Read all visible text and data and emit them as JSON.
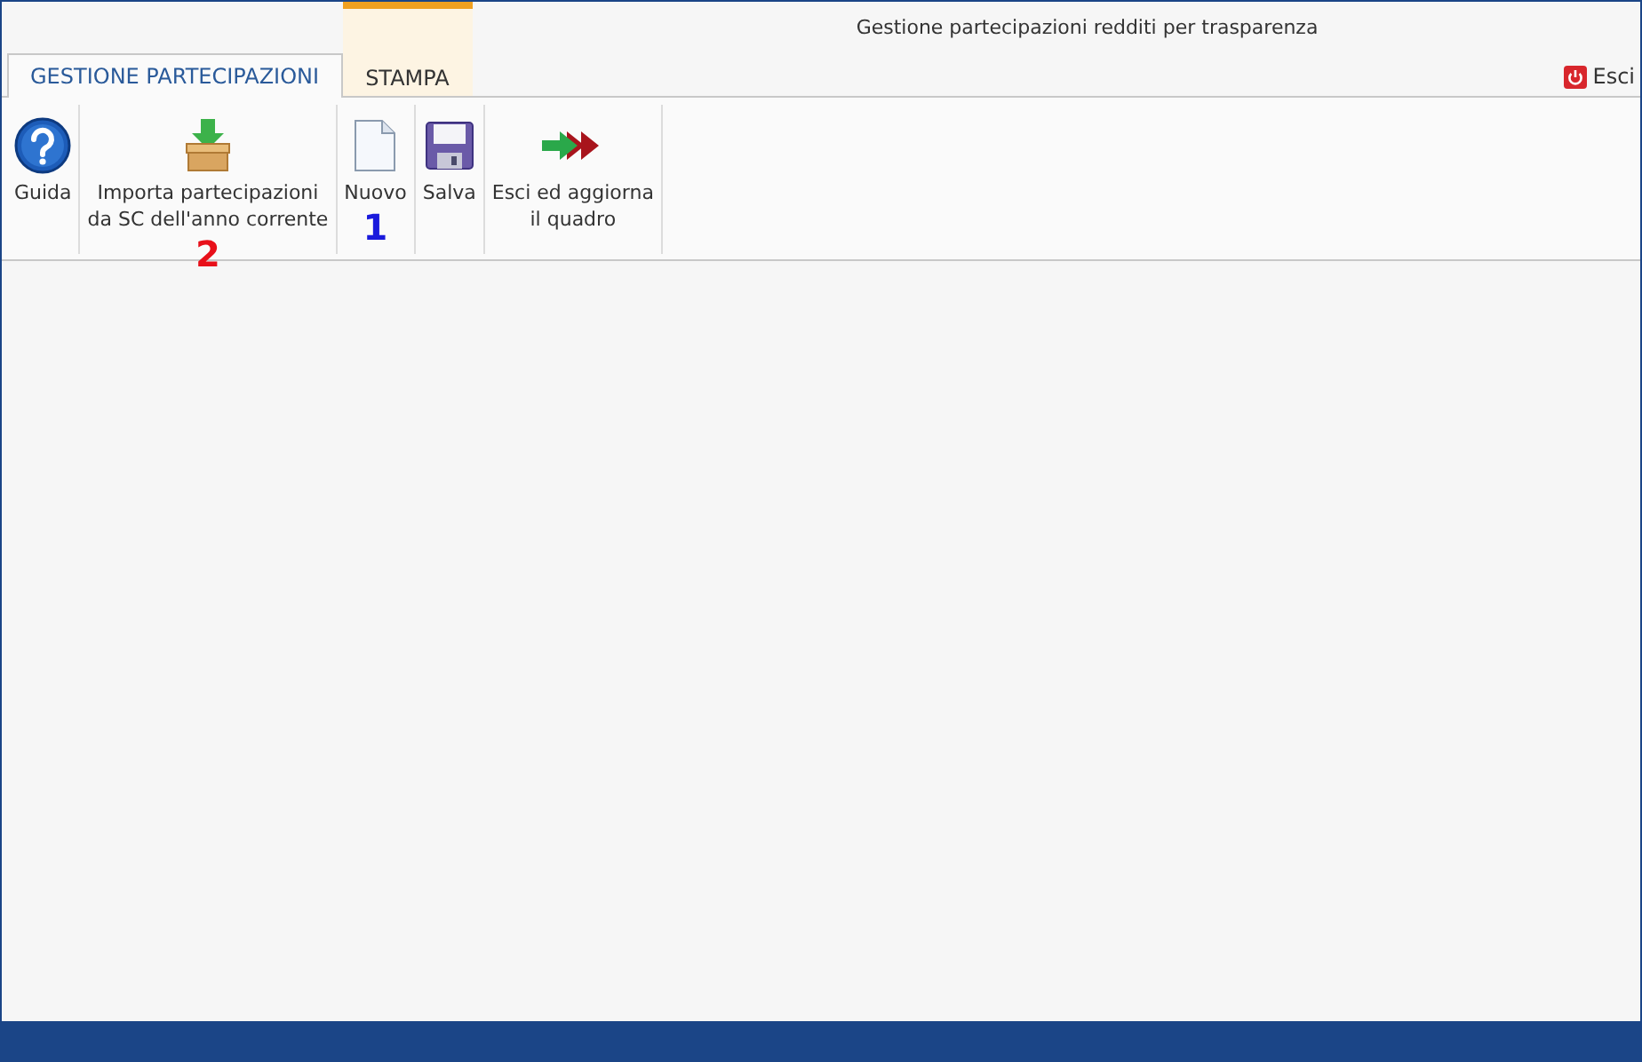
{
  "window": {
    "title": "Gestione partecipazioni redditi per trasparenza"
  },
  "tabs": [
    {
      "label": "GESTIONE PARTECIPAZIONI",
      "selected": true,
      "contextual": false
    },
    {
      "label": "STAMPA",
      "selected": false,
      "contextual": true
    }
  ],
  "exit_button": {
    "label": "Esci"
  },
  "ribbon": [
    {
      "kind": "help",
      "label": "Guida"
    },
    {
      "kind": "import",
      "label": "Importa partecipazioni\nda SC dell'anno corrente",
      "callout": {
        "text": "2",
        "color": "#e8101a"
      }
    },
    {
      "kind": "new",
      "label": "Nuovo",
      "callout": {
        "text": "1",
        "color": "#1a1adc"
      }
    },
    {
      "kind": "save",
      "label": "Salva"
    },
    {
      "kind": "exit",
      "label": "Esci ed aggiorna\nil quadro"
    }
  ]
}
